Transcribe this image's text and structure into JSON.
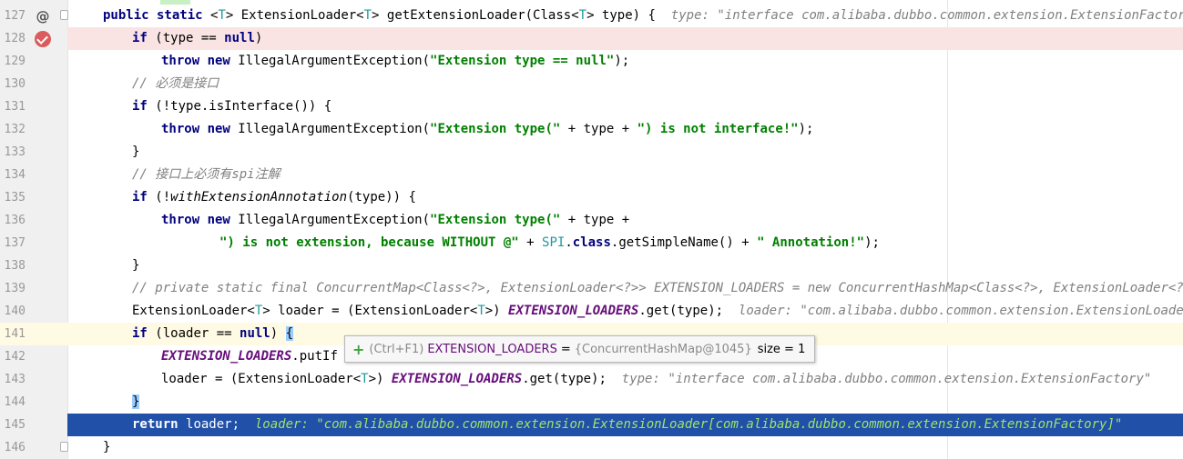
{
  "editor": {
    "lines": [
      {
        "num": "127",
        "marker": "at",
        "indent": 113,
        "tokens": [
          {
            "t": "public static ",
            "c": "kw"
          },
          {
            "t": "<",
            "c": ""
          },
          {
            "t": "T",
            "c": "gen"
          },
          {
            "t": "> ExtensionLoader<",
            "c": ""
          },
          {
            "t": "T",
            "c": "gen"
          },
          {
            "t": "> getExtensionLoader(Class<",
            "c": ""
          },
          {
            "t": "T",
            "c": "gen"
          },
          {
            "t": "> type) {  ",
            "c": ""
          }
        ],
        "hint": "type: \"interface com.alibaba.dubbo.common.extension.ExtensionFactory\""
      },
      {
        "num": "128",
        "marker": "breakpoint",
        "indent": 145,
        "tokens": [
          {
            "t": "if ",
            "c": "kw"
          },
          {
            "t": "(type == ",
            "c": ""
          },
          {
            "t": "null",
            "c": "kw"
          },
          {
            "t": ")",
            "c": ""
          }
        ]
      },
      {
        "num": "129",
        "indent": 177,
        "tokens": [
          {
            "t": "throw new ",
            "c": "kw"
          },
          {
            "t": "IllegalArgumentException(",
            "c": ""
          },
          {
            "t": "\"Extension type == null\"",
            "c": "str"
          },
          {
            "t": ");",
            "c": ""
          }
        ]
      },
      {
        "num": "130",
        "indent": 145,
        "tokens": [
          {
            "t": "// 必须是接口",
            "c": "cm"
          }
        ]
      },
      {
        "num": "131",
        "indent": 145,
        "tokens": [
          {
            "t": "if ",
            "c": "kw"
          },
          {
            "t": "(!type.isInterface()) {",
            "c": ""
          }
        ]
      },
      {
        "num": "132",
        "indent": 177,
        "tokens": [
          {
            "t": "throw new ",
            "c": "kw"
          },
          {
            "t": "IllegalArgumentException(",
            "c": ""
          },
          {
            "t": "\"Extension type(\"",
            "c": "str"
          },
          {
            "t": " + type + ",
            "c": ""
          },
          {
            "t": "\") is not interface!\"",
            "c": "str"
          },
          {
            "t": ");",
            "c": ""
          }
        ]
      },
      {
        "num": "133",
        "indent": 145,
        "tokens": [
          {
            "t": "}",
            "c": ""
          }
        ]
      },
      {
        "num": "134",
        "indent": 145,
        "tokens": [
          {
            "t": "// 接口上必须有spi注解",
            "c": "cm"
          }
        ]
      },
      {
        "num": "135",
        "indent": 145,
        "tokens": [
          {
            "t": "if ",
            "c": "kw"
          },
          {
            "t": "(!",
            "c": ""
          },
          {
            "t": "withExtensionAnnotation",
            "c": "ital"
          },
          {
            "t": "(type)) {",
            "c": ""
          }
        ]
      },
      {
        "num": "136",
        "indent": 177,
        "tokens": [
          {
            "t": "throw new ",
            "c": "kw"
          },
          {
            "t": "IllegalArgumentException(",
            "c": ""
          },
          {
            "t": "\"Extension type(\"",
            "c": "str"
          },
          {
            "t": " + type +",
            "c": ""
          }
        ]
      },
      {
        "num": "137",
        "indent": 241,
        "tokens": [
          {
            "t": "\") is not extension, because WITHOUT @\"",
            "c": "str"
          },
          {
            "t": " + ",
            "c": ""
          },
          {
            "t": "SPI",
            "c": "gen"
          },
          {
            "t": ".",
            "c": ""
          },
          {
            "t": "class",
            "c": "kw"
          },
          {
            "t": ".getSimpleName() + ",
            "c": ""
          },
          {
            "t": "\" Annotation!\"",
            "c": "str"
          },
          {
            "t": ");",
            "c": ""
          }
        ]
      },
      {
        "num": "138",
        "indent": 145,
        "tokens": [
          {
            "t": "}",
            "c": ""
          }
        ]
      },
      {
        "num": "139",
        "indent": 145,
        "tokens": [
          {
            "t": "// private static final ConcurrentMap<Class<?>, ExtensionLoader<?>> EXTENSION_LOADERS = new ConcurrentHashMap<Class<?>, ExtensionLoader<?>>();",
            "c": "cm"
          }
        ]
      },
      {
        "num": "140",
        "indent": 145,
        "tokens": [
          {
            "t": "ExtensionLoader<",
            "c": ""
          },
          {
            "t": "T",
            "c": "gen"
          },
          {
            "t": "> loader = (ExtensionLoader<",
            "c": ""
          },
          {
            "t": "T",
            "c": "gen"
          },
          {
            "t": ">) ",
            "c": ""
          },
          {
            "t": "EXTENSION_LOADERS",
            "c": "fld"
          },
          {
            "t": ".get(type);  ",
            "c": ""
          }
        ],
        "hint": "loader: \"com.alibaba.dubbo.common.extension.ExtensionLoader[com"
      },
      {
        "num": "141",
        "state": "caret",
        "indent": 145,
        "tokens": [
          {
            "t": "if ",
            "c": "kw"
          },
          {
            "t": "(loader == ",
            "c": ""
          },
          {
            "t": "null",
            "c": "kw"
          },
          {
            "t": ") ",
            "c": ""
          },
          {
            "t": "{",
            "c": "brace-hl"
          }
        ]
      },
      {
        "num": "142",
        "indent": 177,
        "tokens": [
          {
            "t": "EXTENSION_LOADERS",
            "c": "fld"
          },
          {
            "t": ".putIf",
            "c": ""
          }
        ]
      },
      {
        "num": "143",
        "indent": 177,
        "tokens": [
          {
            "t": "loader = (ExtensionLoader<",
            "c": ""
          },
          {
            "t": "T",
            "c": "gen"
          },
          {
            "t": ">) ",
            "c": ""
          },
          {
            "t": "EXTENSION_LOADERS",
            "c": "fld"
          },
          {
            "t": ".get(type);  ",
            "c": ""
          }
        ],
        "hint": "type: \"interface com.alibaba.dubbo.common.extension.ExtensionFactory\""
      },
      {
        "num": "144",
        "indent": 145,
        "tokens": [
          {
            "t": "}",
            "c": "brace-hl"
          }
        ]
      },
      {
        "num": "145",
        "state": "exec",
        "indent": 145,
        "tokens": [
          {
            "t": "return ",
            "c": "kw"
          },
          {
            "t": "loader;  ",
            "c": ""
          }
        ],
        "hint": "loader: \"com.alibaba.dubbo.common.extension.ExtensionLoader[com.alibaba.dubbo.common.extension.ExtensionFactory]\""
      },
      {
        "num": "146",
        "indent": 113,
        "tokens": [
          {
            "t": "}",
            "c": ""
          }
        ]
      }
    ]
  },
  "tooltip": {
    "shortcut": "(Ctrl+F1)",
    "name": "EXTENSION_LOADERS",
    "eq": "=",
    "value": "{ConcurrentHashMap@1045}",
    "size": "size = 1"
  },
  "colors": {
    "keyword": "#000080",
    "string": "#008000",
    "comment": "#808080",
    "field": "#660e7a",
    "generic": "#20999d",
    "breakpoint_line": "#fae3e3",
    "execution_line": "#2150a8",
    "caret_line": "#fffae3"
  }
}
